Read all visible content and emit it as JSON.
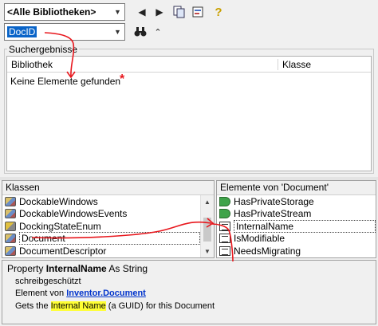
{
  "toolbar": {
    "library_combo_value": "<Alle Bibliotheken>",
    "search_combo_value": "DocID",
    "icons": [
      "back-icon",
      "forward-icon",
      "copy-icon",
      "view-definition-icon",
      "help-icon",
      "binoculars-icon",
      "collapse-icon"
    ]
  },
  "search_results": {
    "group_title": "Suchergebnisse",
    "columns": [
      "Bibliothek",
      "Klasse"
    ],
    "empty_message": "Keine Elemente gefunden"
  },
  "classes": {
    "header": "Klassen",
    "items": [
      {
        "label": "DockableWindows",
        "icon": "class-icon"
      },
      {
        "label": "DockableWindowsEvents",
        "icon": "class-icon"
      },
      {
        "label": "DockingStateEnum",
        "icon": "enum-icon"
      },
      {
        "label": "Document",
        "icon": "class-icon",
        "selected": true
      },
      {
        "label": "DocumentDescriptor",
        "icon": "class-icon"
      }
    ]
  },
  "members": {
    "header": "Elemente von 'Document'",
    "items": [
      {
        "label": "HasPrivateStorage",
        "icon": "method-icon"
      },
      {
        "label": "HasPrivateStream",
        "icon": "method-icon"
      },
      {
        "label": "InternalName",
        "icon": "property-icon",
        "selected": true
      },
      {
        "label": "IsModifiable",
        "icon": "property-icon"
      },
      {
        "label": "NeedsMigrating",
        "icon": "property-icon"
      }
    ]
  },
  "details": {
    "prefix": "Property ",
    "name": "InternalName",
    "type_suffix": " As String",
    "readonly": "schreibgeschützt",
    "member_of_prefix": "Element von ",
    "library_link": "Inventor",
    "dot": ".",
    "class_link": "Document",
    "desc_before": "Gets the ",
    "desc_highlight": "Internal Name",
    "desc_after": " (a GUID) for this Document"
  },
  "annotations": {
    "asterisk": "*",
    "color": "#e8171d"
  }
}
